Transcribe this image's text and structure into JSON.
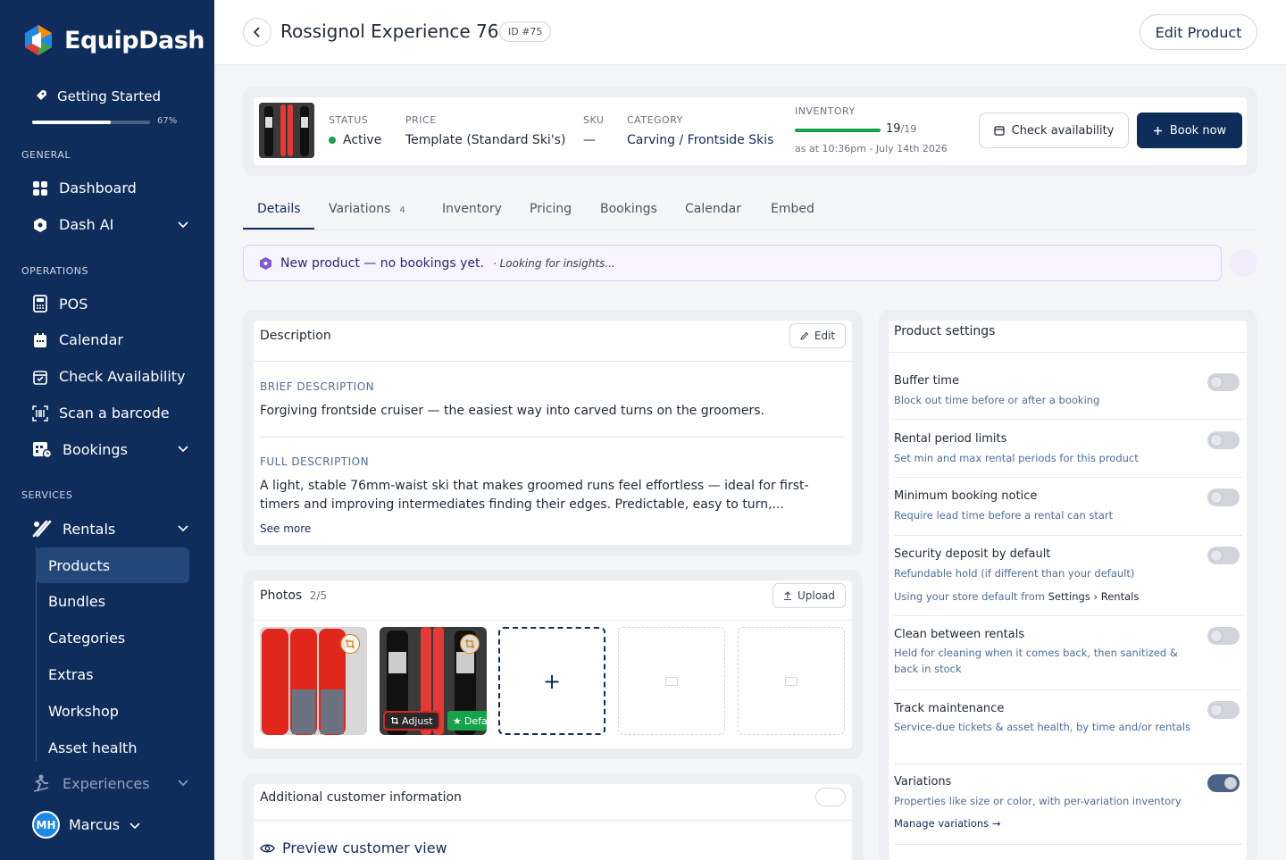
{
  "app": {
    "name": "EquipDash"
  },
  "sidebar": {
    "getting_started": {
      "label": "Getting Started",
      "progress": 67,
      "progress_label": "67%"
    },
    "sections": {
      "general": "GENERAL",
      "operations": "OPERATIONS",
      "services": "SERVICES"
    },
    "general_items": [
      {
        "label": "Dashboard",
        "icon": "grid-icon"
      },
      {
        "label": "Dash AI",
        "icon": "hexagon-icon"
      }
    ],
    "operation_items": [
      {
        "label": "POS",
        "icon": "pos-icon"
      },
      {
        "label": "Calendar",
        "icon": "calendar-icon"
      },
      {
        "label": "Check Availability",
        "icon": "calendar-check-icon"
      },
      {
        "label": "Scan a barcode",
        "icon": "barcode-icon"
      },
      {
        "label": "Bookings",
        "icon": "bookings-icon"
      }
    ],
    "services": {
      "rentals": "Rentals",
      "rental_subitems": [
        "Products",
        "Bundles",
        "Categories",
        "Extras",
        "Workshop",
        "Asset health"
      ],
      "active_subitem": "Products",
      "experiences": "Experiences"
    },
    "user": {
      "initials": "MH",
      "name": "Marcus"
    }
  },
  "header": {
    "title": "Rossignol Experience 76",
    "id_badge": "ID #75",
    "edit_label": "Edit Product"
  },
  "summary": {
    "status_label": "STATUS",
    "status_value": "Active",
    "price_label": "PRICE",
    "price_value": "Template (Standard Ski's)",
    "sku_label": "SKU",
    "sku_value": "—",
    "category_label": "CATEGORY",
    "category_value": "Carving / Frontside Skis",
    "inventory_label": "INVENTORY",
    "inventory_available": "19",
    "inventory_total": "/19",
    "inventory_fraction": 1.0,
    "inventory_timestamp": "as at 10:36pm - July 14th 2026",
    "check_label": "Check availability",
    "book_label": "Book now"
  },
  "tabs": [
    {
      "label": "Details",
      "active": true
    },
    {
      "label": "Variations",
      "count": "4"
    },
    {
      "label": "Inventory"
    },
    {
      "label": "Pricing"
    },
    {
      "label": "Bookings"
    },
    {
      "label": "Calendar"
    },
    {
      "label": "Embed"
    }
  ],
  "banner": {
    "text": "New product — no bookings yet.",
    "subtext": "· Looking for insights..."
  },
  "description": {
    "title": "Description",
    "edit_label": "Edit",
    "brief_label": "BRIEF DESCRIPTION",
    "brief": "Forgiving frontside cruiser — the easiest way into carved turns on the groomers.",
    "full_label": "FULL DESCRIPTION",
    "full": "A light, stable 76mm-waist ski that makes groomed runs feel effortless — ideal for first-timers and improving intermediates finding their edges. Predictable, easy to turn,...",
    "see_more": "See more"
  },
  "photos": {
    "title": "Photos",
    "count": "2/5",
    "upload_label": "Upload",
    "adjust_label": "Adjust",
    "default_label": "Defa",
    "add_symbol": "+"
  },
  "additional": {
    "title": "Additional customer information",
    "preview_label": "Preview customer view"
  },
  "settings": {
    "title": "Product settings",
    "items": [
      {
        "title": "Buffer time",
        "desc": "Block out time before or after a booking",
        "on": false
      },
      {
        "title": "Rental period limits",
        "desc": "Set min and max rental periods for this product",
        "on": false
      },
      {
        "title": "Minimum booking notice",
        "desc": "Require lead time before a rental can start",
        "on": false
      },
      {
        "title": "Security deposit by default",
        "desc": "Refundable hold (if different than your default)",
        "extra_prefix": "Using your store default from",
        "extra_path": "Settings › Rentals",
        "on": false
      },
      {
        "title": "Clean between rentals",
        "desc": "Held for cleaning when it comes back, then sanitized & back in stock",
        "on": false
      },
      {
        "title": "Track maintenance",
        "desc": "Service-due tickets & asset health, by time and/or rentals",
        "on": false
      },
      {
        "title": "Variations",
        "desc": "Properties like size or color, with per-variation inventory",
        "link": "Manage variations →",
        "on": true
      }
    ]
  }
}
